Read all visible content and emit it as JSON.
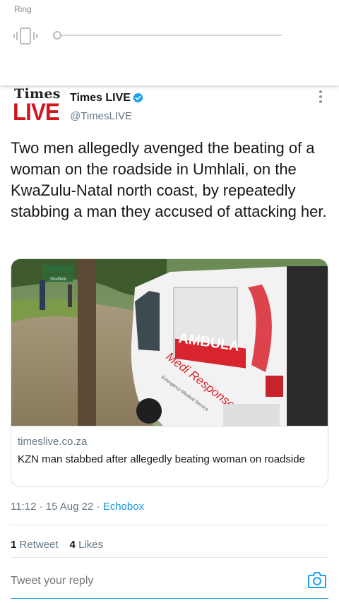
{
  "ringer": {
    "label": "Ring",
    "level": 0,
    "icon": "vibrate-icon"
  },
  "tweet": {
    "logo": {
      "line1": "Times",
      "line2": "LIVE"
    },
    "display_name": "Times LIVE",
    "verified": true,
    "handle": "@TimesLIVE",
    "text": "Two men allegedly avenged the beating of a woman on the roadside in Umhlali, on the KwaZulu-Natal north coast, by repeatedly stabbing a man they accused of attacking her.",
    "card": {
      "image_icon": "ambulance-photo",
      "image_text": {
        "signpost": "Sheffield",
        "ambulance_side": "AMBULA",
        "brand": "Medi Response",
        "service": "Emergency Medical Service"
      },
      "domain": "timeslive.co.za",
      "title": "KZN man stabbed after allegedly beating woman on roadside"
    },
    "time": "11:12",
    "date": "15 Aug 22",
    "source": "Echobox",
    "retweets": "1",
    "retweets_label": "Retweet",
    "likes": "4",
    "likes_label": "Likes"
  },
  "reply": {
    "placeholder": "Tweet your reply"
  },
  "colors": {
    "accent": "#1da1f2",
    "link": "#1b95e0",
    "times_red": "#d0161f",
    "muted": "#657786"
  }
}
